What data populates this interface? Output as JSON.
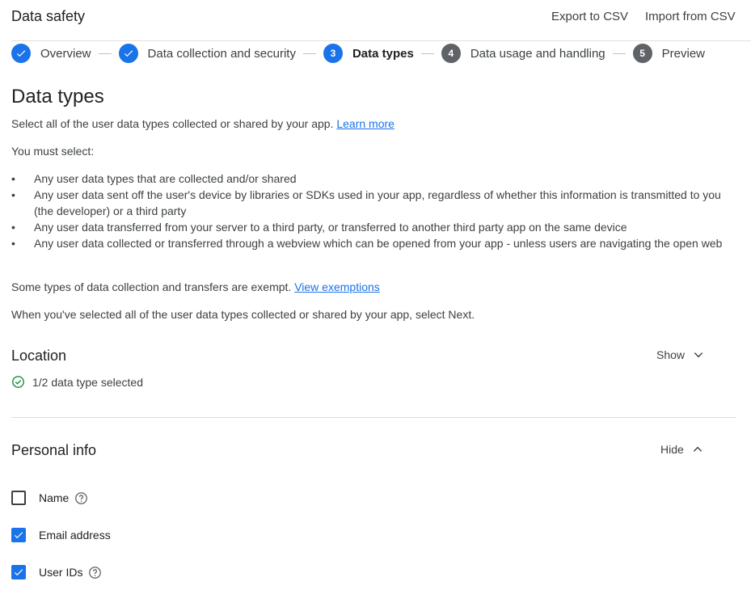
{
  "header": {
    "title": "Data safety",
    "export_label": "Export to CSV",
    "import_label": "Import from CSV"
  },
  "stepper": {
    "steps": [
      {
        "number": "",
        "label": "Overview",
        "state": "done"
      },
      {
        "number": "",
        "label": "Data collection and security",
        "state": "done"
      },
      {
        "number": "3",
        "label": "Data types",
        "state": "active"
      },
      {
        "number": "4",
        "label": "Data usage and handling",
        "state": "todo"
      },
      {
        "number": "5",
        "label": "Preview",
        "state": "todo"
      }
    ]
  },
  "main": {
    "title": "Data types",
    "intro": "Select all of the user data types collected or shared by your app.",
    "intro_link": "Learn more",
    "must_select": "You must select:",
    "bullets": [
      "Any user data types that are collected and/or shared",
      "Any user data sent off the user's device by libraries or SDKs used in your app, regardless of whether this information is transmitted to you (the developer) or a third party",
      "Any user data transferred from your server to a third party, or transferred to another third party app on the same device",
      "Any user data collected or transferred through a webview which can be opened from your app - unless users are navigating the open web"
    ],
    "exempt_text": "Some types of data collection and transfers are exempt.",
    "exempt_link": "View exemptions",
    "next_instruction": "When you've selected all of the user data types collected or shared by your app, select Next."
  },
  "sections": {
    "location": {
      "title": "Location",
      "toggle_label": "Show",
      "status": "1/2 data type selected"
    },
    "personal_info": {
      "title": "Personal info",
      "toggle_label": "Hide",
      "items": [
        {
          "label": "Name",
          "checked": false,
          "has_help": true
        },
        {
          "label": "Email address",
          "checked": true,
          "has_help": false
        },
        {
          "label": "User IDs",
          "checked": true,
          "has_help": true
        }
      ]
    }
  },
  "colors": {
    "accent": "#1a73e8",
    "success": "#1e8e3e",
    "step_inactive": "#5f6368"
  },
  "icons": {
    "step_done": "checkmark-icon",
    "show": "chevron-down-icon",
    "hide": "chevron-up-icon",
    "status": "check-circle-icon",
    "help": "help-circle-icon"
  }
}
